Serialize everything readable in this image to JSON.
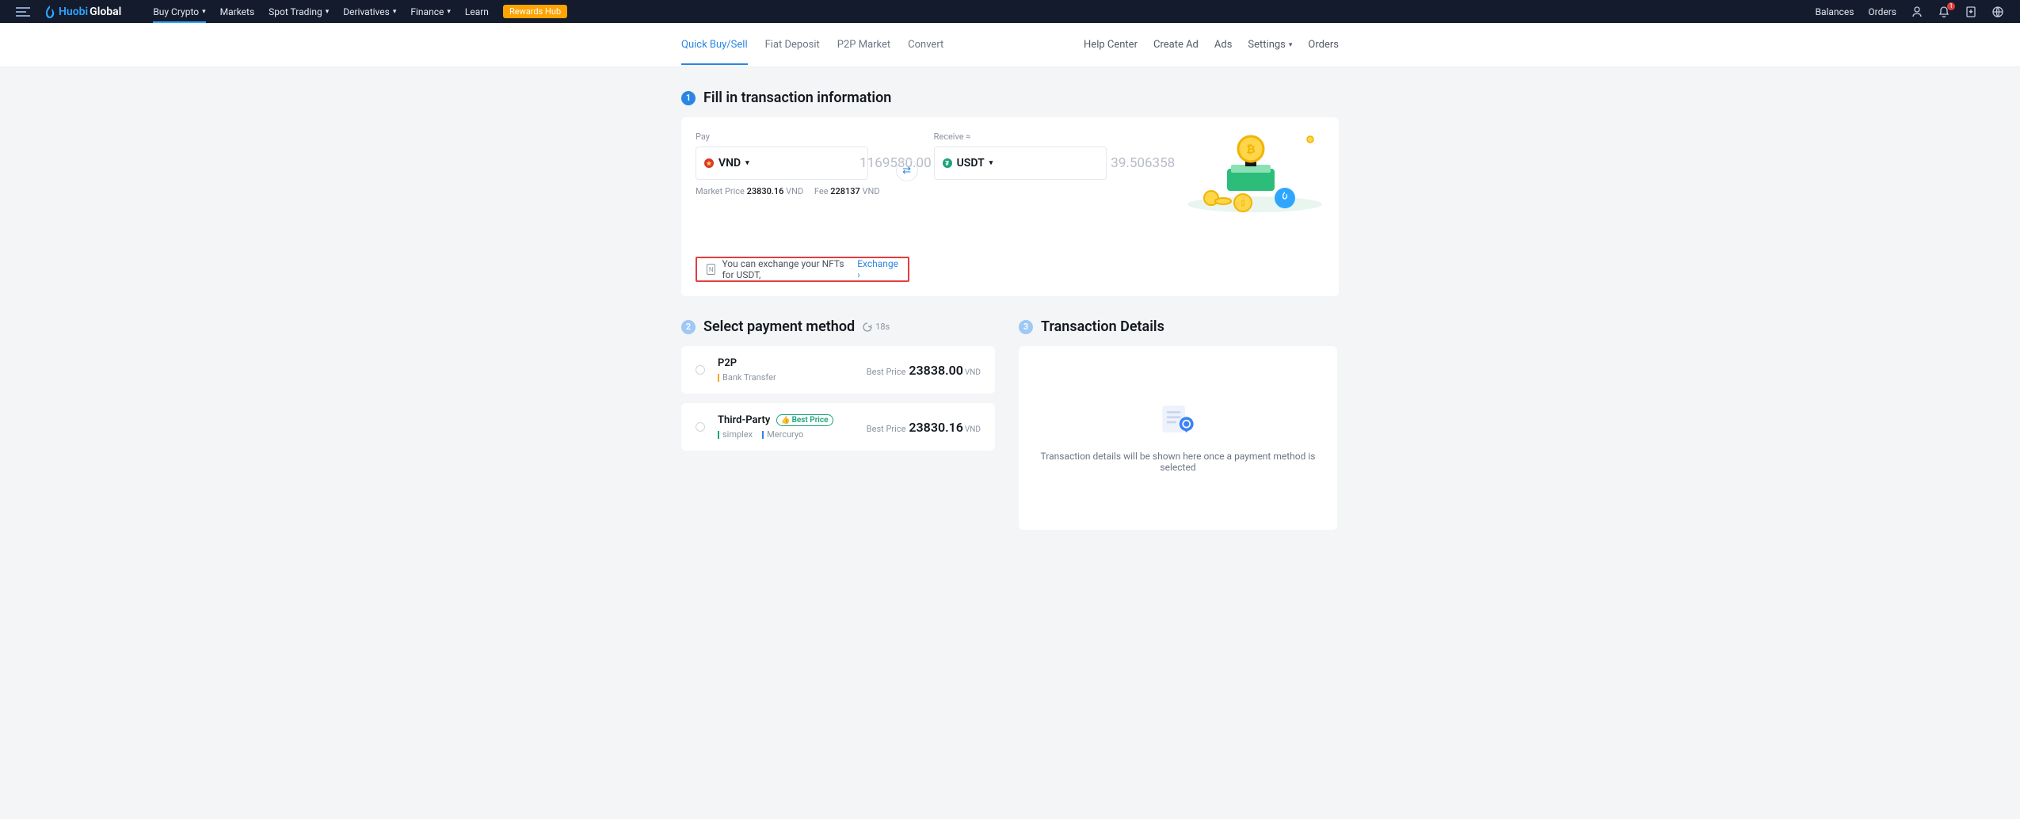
{
  "topbar": {
    "logo_a": "Huobi",
    "logo_b": "Global",
    "nav": {
      "buy_crypto": "Buy Crypto",
      "markets": "Markets",
      "spot_trading": "Spot Trading",
      "derivatives": "Derivatives",
      "finance": "Finance",
      "learn": "Learn",
      "rewards_hub": "Rewards Hub"
    },
    "right": {
      "balances": "Balances",
      "orders": "Orders",
      "notification_count": "1"
    }
  },
  "subbar": {
    "tabs": {
      "quick": "Quick Buy/Sell",
      "fiat": "Fiat Deposit",
      "p2p": "P2P Market",
      "convert": "Convert"
    },
    "links": {
      "help": "Help Center",
      "create_ad": "Create Ad",
      "ads": "Ads",
      "settings": "Settings",
      "orders": "Orders"
    }
  },
  "step1": {
    "num": "1",
    "title": "Fill in transaction information",
    "pay_label": "Pay",
    "pay_currency": "VND",
    "pay_value": "1169580.00",
    "receive_label": "Receive ≈",
    "receive_currency": "USDT",
    "receive_value": "39.506358",
    "market_price_label": "Market Price ",
    "market_price_val": "23830.16",
    "market_price_cur": " VND",
    "fee_label": "Fee ",
    "fee_val": "228137",
    "fee_cur": " VND",
    "nft_text": "You can exchange your NFTs for USDT,",
    "nft_link": "Exchange"
  },
  "step2": {
    "num": "2",
    "title": "Select payment method",
    "refresh": "18s",
    "opts": [
      {
        "title": "P2P",
        "providers": [
          {
            "label": "Bank Transfer",
            "cls": "bar-orange"
          }
        ],
        "best_badge": "",
        "bp": "Best Price",
        "amount": "23838.00",
        "cur": "VND"
      },
      {
        "title": "Third-Party",
        "providers": [
          {
            "label": "simplex",
            "cls": "bar-green"
          },
          {
            "label": "Mercuryo",
            "cls": "bar-blue"
          }
        ],
        "best_badge": "Best Price",
        "bp": "Best Price",
        "amount": "23830.16",
        "cur": "VND"
      }
    ]
  },
  "step3": {
    "num": "3",
    "title": "Transaction Details",
    "empty_msg": "Transaction details will be shown here once a payment method is selected"
  }
}
